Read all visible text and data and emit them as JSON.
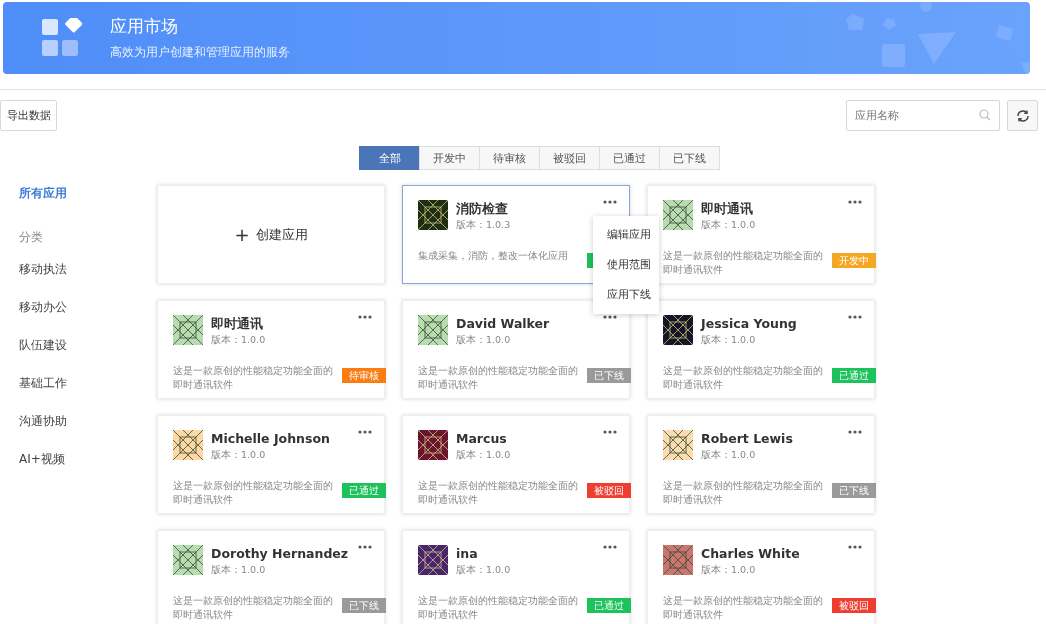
{
  "header": {
    "title": "应用市场",
    "subtitle": "高效为用户创建和管理应用的服务"
  },
  "toolbar": {
    "export_button": "导出数据",
    "search": {
      "placeholder": "应用名称"
    }
  },
  "tabs": [
    {
      "label": "全部",
      "selected": true
    },
    {
      "label": "开发中",
      "selected": false
    },
    {
      "label": "待审核",
      "selected": false
    },
    {
      "label": "被驳回",
      "selected": false
    },
    {
      "label": "已通过",
      "selected": false
    },
    {
      "label": "已下线",
      "selected": false
    }
  ],
  "sidebar": {
    "items": [
      {
        "label": "所有应用",
        "kind": "item",
        "selected": true
      },
      {
        "label": "分类",
        "kind": "header"
      },
      {
        "label": "移动执法",
        "kind": "item",
        "selected": false
      },
      {
        "label": "移动办公",
        "kind": "item",
        "selected": false
      },
      {
        "label": "队伍建设",
        "kind": "item",
        "selected": false
      },
      {
        "label": "基础工作",
        "kind": "item",
        "selected": false
      },
      {
        "label": "沟通协助",
        "kind": "item",
        "selected": false
      },
      {
        "label": "AI+视频",
        "kind": "item",
        "selected": false
      }
    ]
  },
  "create_card": {
    "label": "创建应用",
    "icon": "+"
  },
  "apps": [
    {
      "name": "消防检查",
      "version": "版本：1.0.3",
      "description": "集成采集，消防，整改一体化应用",
      "status": {
        "kind": "passed"
      },
      "color": "#1f2d12",
      "selected": true,
      "menu": [
        "编辑应用",
        "使用范围",
        "应用下线"
      ]
    },
    {
      "name": "即时通讯",
      "version": "版本：1.0.0",
      "description": "这是一款原创的性能稳定功能全面的即时通讯软件",
      "status": {
        "kind": "developing",
        "text": "开发中"
      },
      "color": "#b6dcb0",
      "selected": false
    },
    {
      "name": "即时通讯",
      "version": "版本：1.0.0",
      "description": "这是一款原创的性能稳定功能全面的即时通讯软件",
      "status": {
        "kind": "review",
        "text": "待审核"
      },
      "color": "#b6dcb0",
      "selected": false
    },
    {
      "name": "David Walker",
      "version": "版本：1.0.0",
      "description": "这是一款原创的性能稳定功能全面的即时通讯软件",
      "status": {
        "kind": "offline",
        "text": "已下线"
      },
      "color": "#b6dcb0",
      "selected": false
    },
    {
      "name": "Jessica Young",
      "version": "版本：1.0.0",
      "description": "这是一款原创的性能稳定功能全面的即时通讯软件",
      "status": {
        "kind": "passed",
        "text": "已通过"
      },
      "color": "#15152a",
      "selected": false
    },
    {
      "name": "Michelle Johnson",
      "version": "版本：1.0.0",
      "description": "这是一款原创的性能稳定功能全面的即时通讯软件",
      "status": {
        "kind": "passed",
        "text": "已通过"
      },
      "color": "#fbd9a0",
      "selected": false
    },
    {
      "name": "Marcus",
      "version": "版本：1.0.0",
      "description": "这是一款原创的性能稳定功能全面的即时通讯软件",
      "status": {
        "kind": "rejected",
        "text": "被驳回"
      },
      "color": "#6b1430",
      "selected": false
    },
    {
      "name": "Robert Lewis",
      "version": "版本：1.0.0",
      "description": "这是一款原创的性能稳定功能全面的即时通讯软件",
      "status": {
        "kind": "offline",
        "text": "已下线"
      },
      "color": "#fbdcb0",
      "selected": false
    },
    {
      "name": "Dorothy Hernandez",
      "version": "版本：1.0.0",
      "description": "这是一款原创的性能稳定功能全面的即时通讯软件",
      "status": {
        "kind": "offline",
        "text": "已下线"
      },
      "color": "#b6dcb0",
      "selected": false
    },
    {
      "name": "ina",
      "version": "版本：1.0.0",
      "description": "这是一款原创的性能稳定功能全面的即时通讯软件",
      "status": {
        "kind": "passed",
        "text": "已通过"
      },
      "color": "#4a2470",
      "selected": false
    },
    {
      "name": "Charles White",
      "version": "版本：1.0.0",
      "description": "这是一款原创的性能稳定功能全面的即时通讯软件",
      "status": {
        "kind": "rejected",
        "text": "被驳回"
      },
      "color": "#c8766e",
      "selected": false
    }
  ]
}
